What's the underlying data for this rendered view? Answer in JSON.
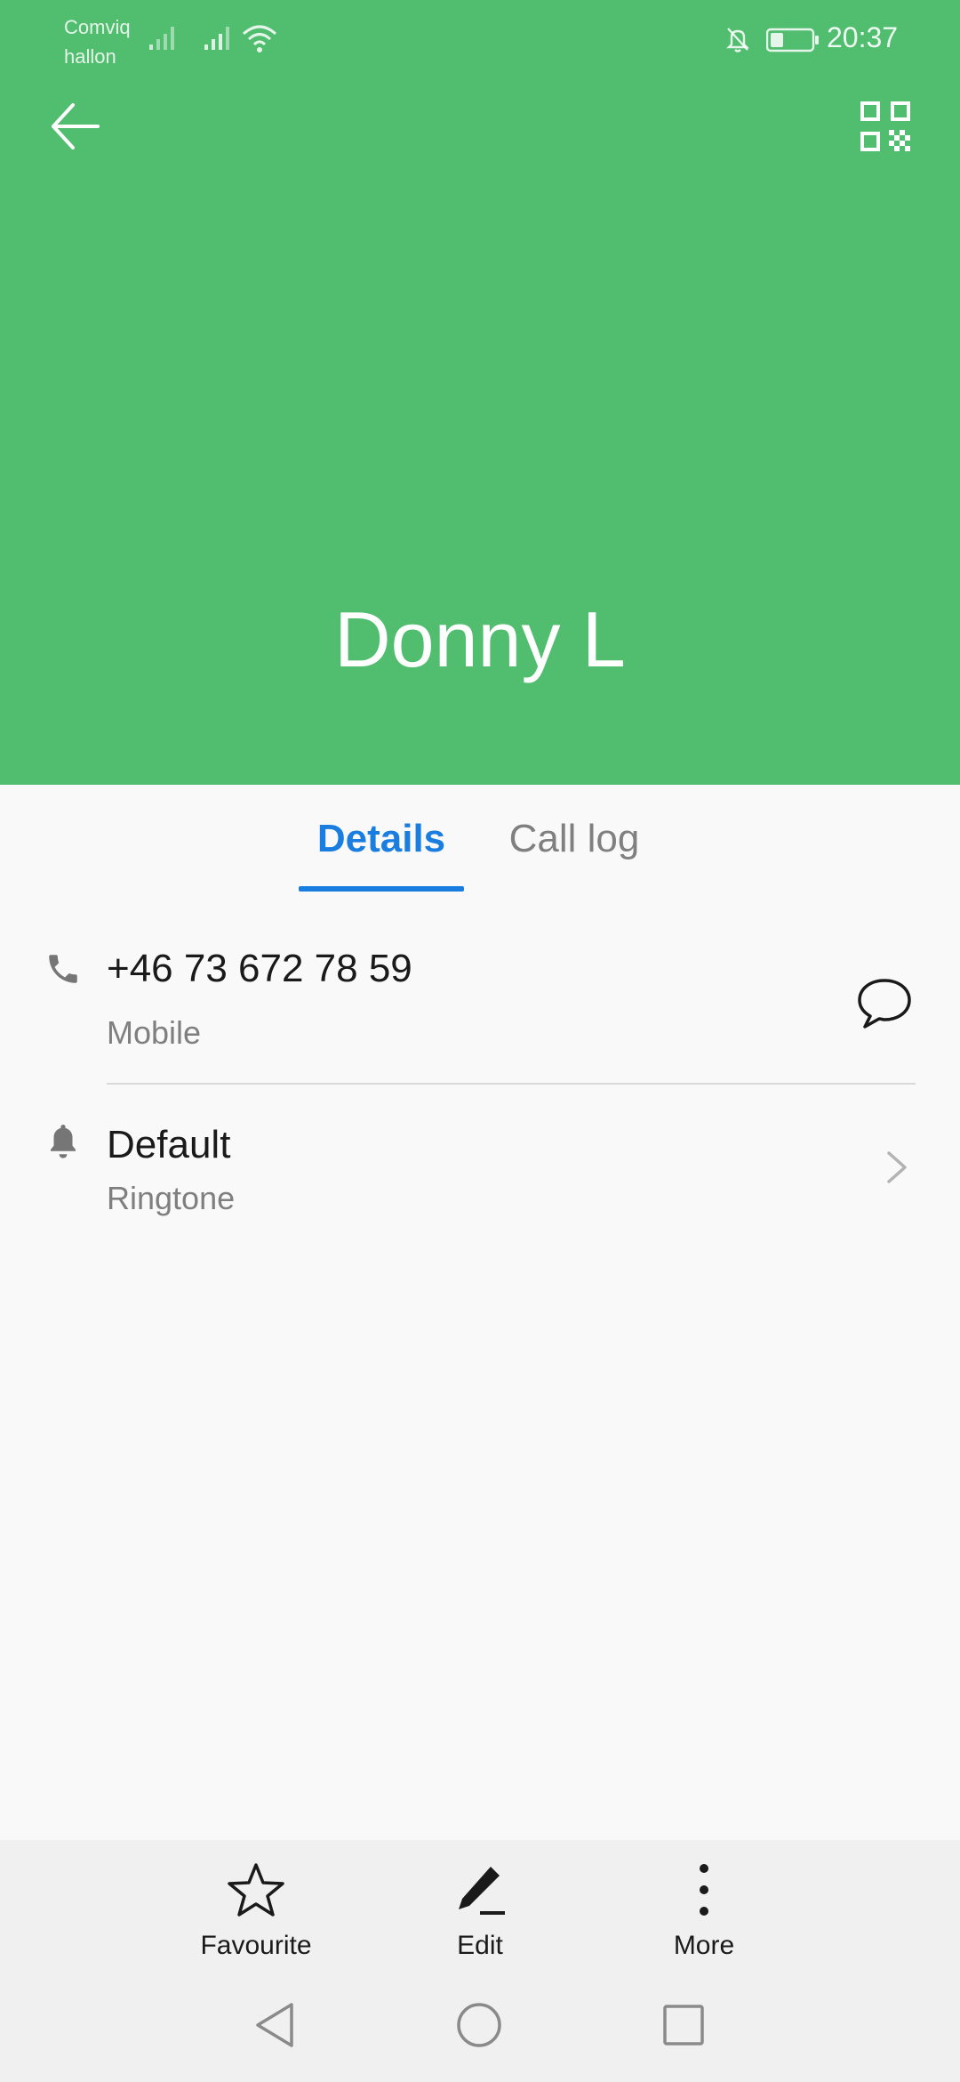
{
  "colors": {
    "header_bg": "#50bd6f",
    "accent": "#1a7ee0"
  },
  "status_bar": {
    "carrier_line1": "Comviq",
    "carrier_line2": "hallon",
    "time": "20:37",
    "icons": [
      "signal-icon",
      "signal-icon",
      "wifi-icon",
      "notifications-off-icon",
      "battery-icon"
    ]
  },
  "header": {
    "contact_name": "Donny L",
    "back_icon": "arrow-back-icon",
    "qr_icon": "qr-code-icon"
  },
  "tabs": [
    {
      "label": "Details",
      "selected": true
    },
    {
      "label": "Call log",
      "selected": false
    }
  ],
  "details": {
    "phone": {
      "number": "+46 73 672 78 59",
      "type": "Mobile",
      "icon": "phone-icon",
      "action_icon": "message-icon"
    },
    "ringtone": {
      "value": "Default",
      "label": "Ringtone",
      "icon": "bell-icon",
      "action_icon": "chevron-right-icon"
    }
  },
  "actions": [
    {
      "label": "Favourite",
      "icon": "star-icon"
    },
    {
      "label": "Edit",
      "icon": "edit-icon"
    },
    {
      "label": "More",
      "icon": "more-vertical-icon"
    }
  ],
  "nav": [
    "nav-back-icon",
    "nav-home-icon",
    "nav-recents-icon"
  ]
}
